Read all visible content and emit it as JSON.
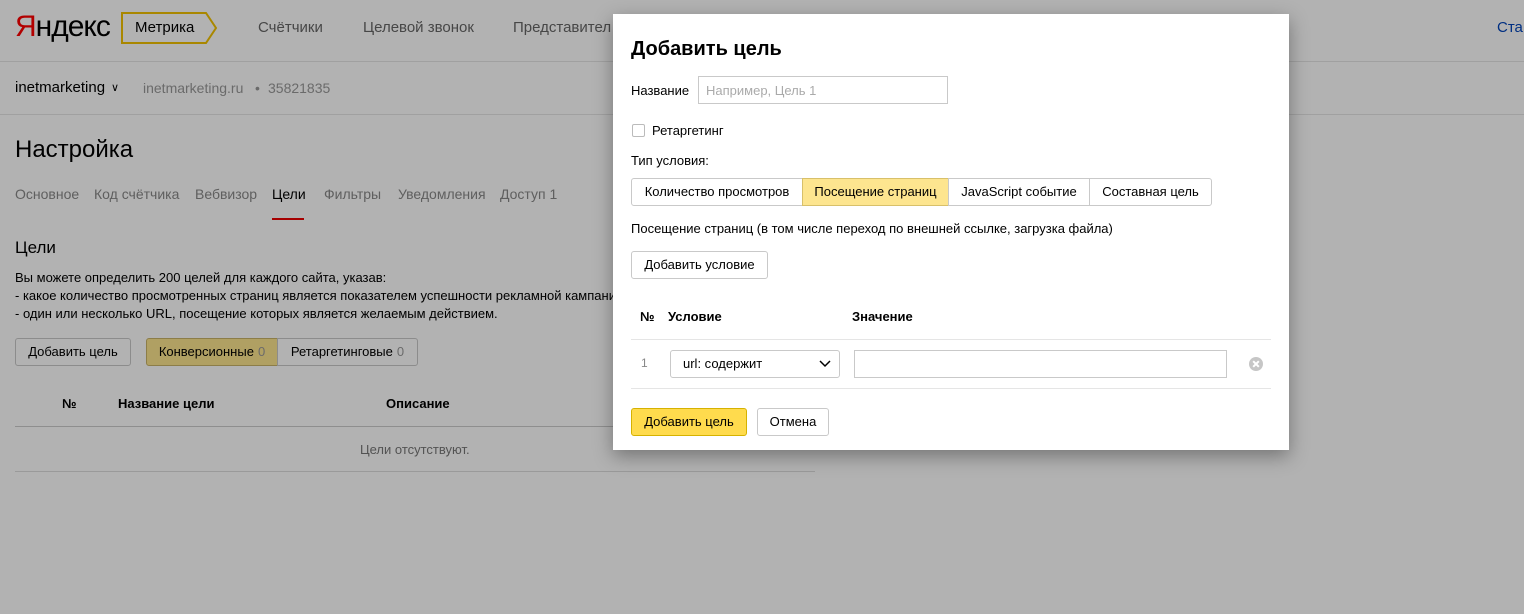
{
  "header": {
    "logo_first": "Я",
    "logo_rest": "ндекс",
    "product": "Метрика",
    "nav": [
      "Счётчики",
      "Целевой звонок",
      "Представител"
    ],
    "right_link": "Ста"
  },
  "counter": {
    "name": "inetmarketing",
    "site": "inetmarketing.ru",
    "separator": "•",
    "id": "35821835"
  },
  "page_title": "Настройка",
  "tabs": [
    "Основное",
    "Код счётчика",
    "Вебвизор",
    "Цели",
    "Фильтры",
    "Уведомления",
    "Доступ 1"
  ],
  "active_tab": "Цели",
  "goals": {
    "title": "Цели",
    "desc_lines": [
      "Вы можете определить 200 целей для каждого сайта, указав:",
      "- какое количество просмотренных страниц является показателем успешности рекламной кампании",
      "- один или несколько URL, посещение которых является желаемым действием."
    ],
    "add_button": "Добавить цель",
    "filters": [
      {
        "label": "Конверсионные",
        "count": "0",
        "active": true
      },
      {
        "label": "Ретаргетинговые",
        "count": "0",
        "active": false
      }
    ],
    "columns": [
      "№",
      "Название цели",
      "Описание"
    ],
    "empty_text": "Цели отсутствуют."
  },
  "modal": {
    "title": "Добавить цель",
    "name_label": "Название",
    "name_placeholder": "Например, Цель 1",
    "retargeting_label": "Ретаргетинг",
    "condition_type_label": "Тип условия:",
    "condition_types": [
      "Количество просмотров",
      "Посещение страниц",
      "JavaScript событие",
      "Составная цель"
    ],
    "active_condition_type": "Посещение страниц",
    "condition_desc": "Посещение страниц (в том числе переход по внешней ссылке, загрузка файла)",
    "add_condition_button": "Добавить условие",
    "table_headers": [
      "№",
      "Условие",
      "Значение"
    ],
    "rows": [
      {
        "num": "1",
        "condition": "url: содержит",
        "value": ""
      }
    ],
    "submit_button": "Добавить цель",
    "cancel_button": "Отмена"
  },
  "colors": {
    "accent_yellow": "#ffdb4d",
    "active_segment": "#fde58f",
    "tab_underline": "#e00000",
    "logo_red": "#ff0000",
    "link": "#0044bb"
  }
}
